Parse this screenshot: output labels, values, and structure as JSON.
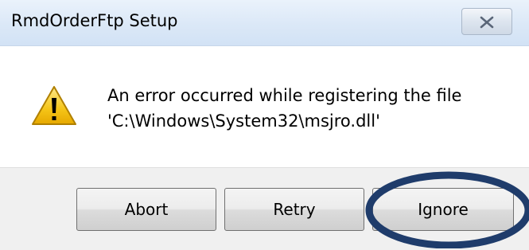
{
  "window": {
    "title": "RmdOrderFtp Setup",
    "close_icon": "close-icon"
  },
  "message": {
    "icon": "warning-icon",
    "line1": "An error occurred while registering the file",
    "line2": "'C:\\Windows\\System32\\msjro.dll'"
  },
  "buttons": {
    "abort": "Abort",
    "retry": "Retry",
    "ignore": "Ignore"
  },
  "annotation": {
    "highlight_color": "#1f3c6b",
    "highlight_target": "ignore"
  },
  "colors": {
    "titlebar": "#dbe8f7",
    "footer": "#f0f0f0",
    "warning_fill": "#f5c518"
  }
}
